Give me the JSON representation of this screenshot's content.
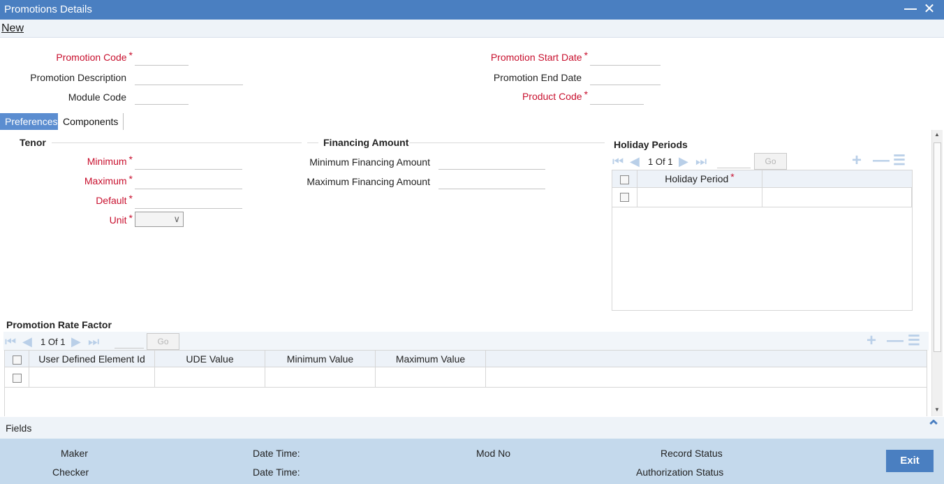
{
  "window": {
    "title": "Promotions Details",
    "minimize": "▬",
    "close": "✕"
  },
  "toolbar": {
    "new_label": "New"
  },
  "header_form": {
    "promotion_code": {
      "label": "Promotion Code",
      "required": "*",
      "value": ""
    },
    "promotion_description": {
      "label": "Promotion Description",
      "value": ""
    },
    "module_code": {
      "label": "Module Code",
      "value": ""
    },
    "promotion_start_date": {
      "label": "Promotion Start Date",
      "required": "*",
      "value": ""
    },
    "promotion_end_date": {
      "label": "Promotion End Date",
      "value": ""
    },
    "product_code": {
      "label": "Product Code",
      "required": "*",
      "value": ""
    }
  },
  "tabs": [
    {
      "label": "Preferences",
      "active": true
    },
    {
      "label": "Components",
      "active": false
    }
  ],
  "tenor": {
    "title": "Tenor",
    "minimum": {
      "label": "Minimum",
      "required": "*",
      "value": ""
    },
    "maximum": {
      "label": "Maximum",
      "required": "*",
      "value": ""
    },
    "default": {
      "label": "Default",
      "required": "*",
      "value": ""
    },
    "unit": {
      "label": "Unit",
      "required": "*",
      "value": ""
    }
  },
  "financing": {
    "title": "Financing Amount",
    "minimum": {
      "label": "Minimum Financing Amount",
      "value": ""
    },
    "maximum": {
      "label": "Maximum Financing Amount",
      "value": ""
    }
  },
  "holiday_periods": {
    "title": "Holiday Periods",
    "page_current": "1",
    "page_of": "Of",
    "page_total": "1",
    "go_label": "Go",
    "columns": [
      {
        "label": "Holiday Period",
        "required": "*"
      }
    ]
  },
  "promotion_rate_factor": {
    "title": "Promotion Rate Factor",
    "page_current": "1",
    "page_of": "Of",
    "page_total": "1",
    "go_label": "Go",
    "columns": [
      {
        "label": "User Defined Element Id"
      },
      {
        "label": "UDE Value"
      },
      {
        "label": "Minimum Value"
      },
      {
        "label": "Maximum Value"
      }
    ]
  },
  "fields_bar": {
    "label": "Fields"
  },
  "footer": {
    "maker": "Maker",
    "checker": "Checker",
    "maker_datetime": "Date Time:",
    "checker_datetime": "Date Time:",
    "mod_no": "Mod No",
    "record_status": "Record Status",
    "authorization_status": "Authorization Status",
    "exit_label": "Exit"
  },
  "colors": {
    "title_bar": "#4a7fc1",
    "required_label": "#c8102e",
    "footer": "#c4d9ec",
    "active_tab": "#5b8dd0"
  },
  "icons": [
    "minimize-icon",
    "close-icon",
    "first-page-icon",
    "prev-page-icon",
    "next-page-icon",
    "last-page-icon",
    "add-row-icon",
    "delete-row-icon",
    "list-view-icon",
    "expand-up-icon",
    "chevron-down-icon"
  ]
}
